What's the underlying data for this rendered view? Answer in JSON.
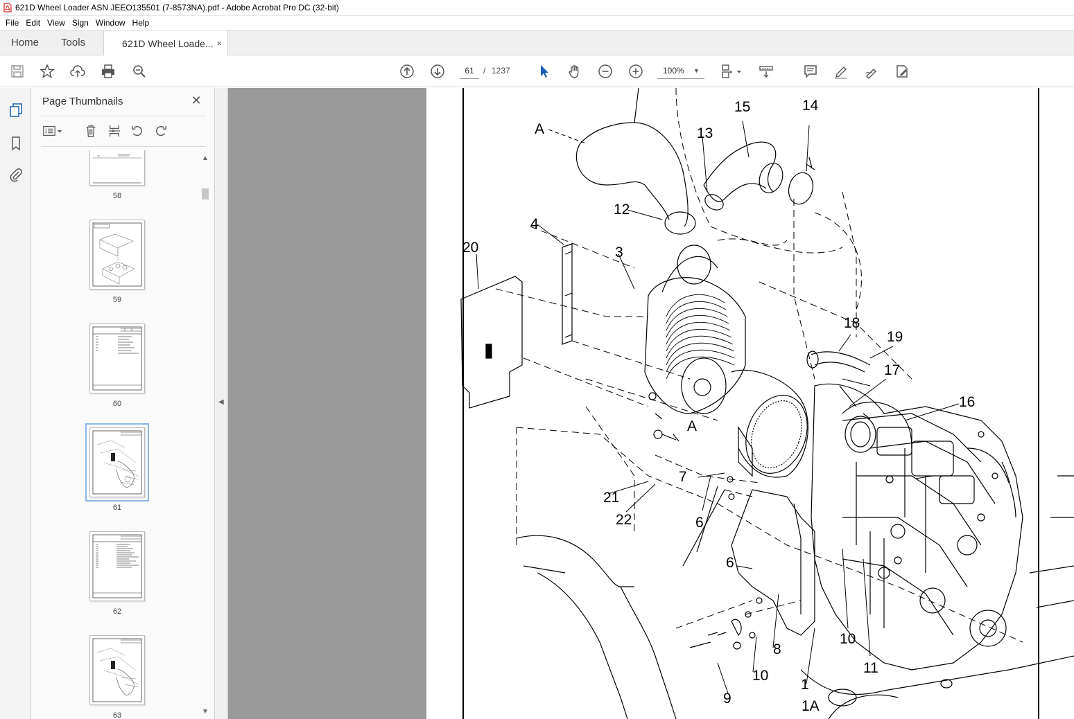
{
  "window": {
    "title": "621D Wheel Loader ASN JEEO135501 (7-8573NA).pdf - Adobe Acrobat Pro DC (32-bit)"
  },
  "menu": [
    "File",
    "Edit",
    "View",
    "Sign",
    "Window",
    "Help"
  ],
  "tabs": {
    "home": "Home",
    "tools": "Tools",
    "document": "621D Wheel Loade...",
    "close": "×"
  },
  "toolbar": {
    "current_page": "61",
    "page_separator": "/",
    "total_pages": "1237",
    "zoom": "100%"
  },
  "thumbnails": {
    "title": "Page Thumbnails",
    "close": "✕",
    "pages": [
      "58",
      "59",
      "60",
      "61",
      "62",
      "63"
    ],
    "selected_page": "61"
  },
  "diagram": {
    "callouts": [
      "A",
      "15",
      "14",
      "13",
      "12",
      "4",
      "20",
      "3",
      "18",
      "19",
      "17",
      "16",
      "A",
      "7",
      "21",
      "22",
      "6",
      "6",
      "10",
      "8",
      "10",
      "11",
      "9",
      "1",
      "1A"
    ]
  },
  "colors": {
    "accent_blue": "#1a5fb4",
    "gray_background": "#9a9a9a",
    "selection_outline": "#8cb6e6"
  }
}
